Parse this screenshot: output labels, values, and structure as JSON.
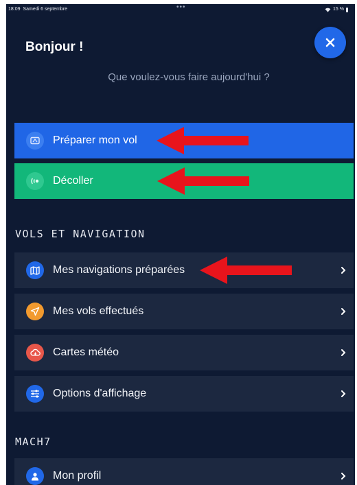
{
  "status_bar": {
    "time": "18:09",
    "date": "Samedi 6 septembre",
    "dots": "•••",
    "battery": "15 %"
  },
  "header": {
    "greeting": "Bonjour !",
    "subtitle": "Que voulez-vous faire aujourd'hui ?"
  },
  "actions": [
    {
      "label": "Préparer mon vol",
      "icon": "flight-plan-icon",
      "color": "#2066e6"
    },
    {
      "label": "Décoller",
      "icon": "takeoff-icon",
      "color": "#12b77a"
    }
  ],
  "sections": {
    "vols": "VOLS ET NAVIGATION",
    "mach7": "MACH7"
  },
  "menu": [
    {
      "label": "Mes navigations préparées",
      "icon": "map-icon",
      "color": "#2168e8"
    },
    {
      "label": "Mes vols effectués",
      "icon": "paper-plane-icon",
      "color": "#f29a2e"
    },
    {
      "label": "Cartes météo",
      "icon": "cloud-icon",
      "color": "#e8574a"
    },
    {
      "label": "Options d'affichage",
      "icon": "sliders-icon",
      "color": "#2168e8"
    },
    {
      "label": "Mon profil",
      "icon": "user-icon",
      "color": "#2168e8"
    }
  ],
  "annotation_color": "#e8141c"
}
